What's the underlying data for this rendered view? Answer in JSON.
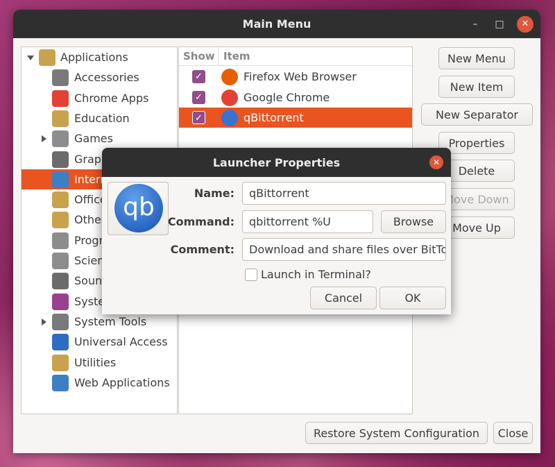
{
  "window": {
    "title": "Main Menu",
    "controls": {
      "minimize": "–",
      "maximize": "□",
      "close": "✕"
    }
  },
  "tree": {
    "items": [
      {
        "label": "Applications",
        "icon": "applications-icon",
        "expander": "down",
        "color": "#c9a24e"
      },
      {
        "label": "Accessories",
        "icon": "accessories-icon",
        "color": "#7a7a7a"
      },
      {
        "label": "Chrome Apps",
        "icon": "chrome-icon",
        "color": "#e34133"
      },
      {
        "label": "Education",
        "icon": "education-icon",
        "color": "#c9a24e"
      },
      {
        "label": "Games",
        "icon": "games-icon",
        "expander": "right",
        "color": "#8d8d8d"
      },
      {
        "label": "Graphics",
        "icon": "graphics-icon",
        "color": "#6b6b6b"
      },
      {
        "label": "Internet",
        "icon": "internet-icon",
        "selected": true,
        "color": "#3d7fc4"
      },
      {
        "label": "Office",
        "icon": "office-icon",
        "color": "#c9a24e"
      },
      {
        "label": "Other",
        "icon": "other-icon",
        "color": "#c9a24e"
      },
      {
        "label": "Programming",
        "icon": "programming-icon",
        "color": "#8d8d8d"
      },
      {
        "label": "Science",
        "icon": "science-icon",
        "color": "#8d8d8d"
      },
      {
        "label": "Sound & Video",
        "icon": "sound-video-icon",
        "color": "#6b6b6b"
      },
      {
        "label": "System",
        "icon": "system-icon",
        "color": "#9b3f8f"
      },
      {
        "label": "System Tools",
        "icon": "system-tools-icon",
        "expander": "right",
        "color": "#7a7a7a"
      },
      {
        "label": "Universal Access",
        "icon": "accessibility-icon",
        "color": "#2e6cc2"
      },
      {
        "label": "Utilities",
        "icon": "utilities-icon",
        "color": "#c9a24e"
      },
      {
        "label": "Web Applications",
        "icon": "web-applications-icon",
        "color": "#3d7fc4"
      }
    ]
  },
  "items": {
    "header_show": "Show",
    "header_item": "Item",
    "rows": [
      {
        "label": "Firefox Web Browser",
        "icon": "firefox-icon",
        "checked": true,
        "color": "#e66000"
      },
      {
        "label": "Google Chrome",
        "icon": "chrome-icon",
        "checked": true,
        "color": "#e34133"
      },
      {
        "label": "qBittorrent",
        "icon": "qbittorrent-icon",
        "checked": true,
        "selected": true,
        "color": "#3a73cf"
      }
    ]
  },
  "buttons": {
    "new_menu": "New Menu",
    "new_item": "New Item",
    "new_separator": "New Separator",
    "properties": "Properties",
    "delete": "Delete",
    "move_down": "Move Down",
    "move_up": "Move Up",
    "restore": "Restore System Configuration",
    "close": "Close"
  },
  "dialog": {
    "title": "Launcher Properties",
    "icon_text": "qb",
    "name_label": "Name:",
    "name_value": "qBittorrent",
    "command_label": "Command:",
    "command_value": "qbittorrent %U",
    "browse": "Browse",
    "comment_label": "Comment:",
    "comment_value": "Download and share files over BitTor",
    "terminal_label": "Launch in Terminal?",
    "cancel": "Cancel",
    "ok": "OK",
    "close": "✕"
  },
  "colors": {
    "accent": "#e95420",
    "checkbox": "#924d8b",
    "titlebar": "#2f2f2f"
  }
}
